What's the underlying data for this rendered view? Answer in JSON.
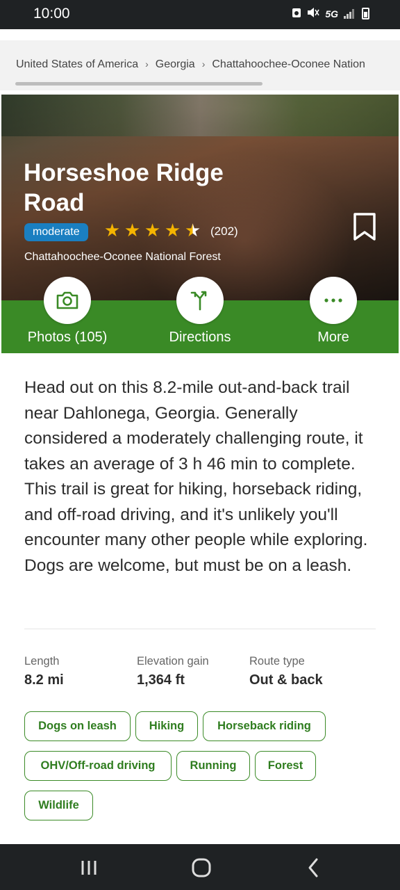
{
  "status_bar": {
    "time": "10:00",
    "network": "5G"
  },
  "breadcrumb": {
    "items": [
      "United States of America",
      "Georgia",
      "Chattahoochee-Oconee Nation"
    ],
    "separator": "›"
  },
  "hero": {
    "title": "Horseshoe Ridge Road",
    "difficulty": "moderate",
    "rating": 4.5,
    "rating_max": 5,
    "reviews": "(202)",
    "park": "Chattahoochee-Oconee National Forest"
  },
  "actions": {
    "photos_label": "Photos (105)",
    "directions_label": "Directions",
    "more_label": "More"
  },
  "description": "Head out on this 8.2-mile out-and-back trail near Dahlonega, Georgia. Generally considered a moderately challenging route, it takes an average of 3 h 46 min to complete. This trail is great for hiking, horseback riding, and off-road driving, and it's unlikely you'll encounter many other people while exploring. Dogs are welcome, but must be on a leash.",
  "stats": {
    "length": {
      "label": "Length",
      "value": "8.2 mi"
    },
    "elevation": {
      "label": "Elevation gain",
      "value": "1,364 ft"
    },
    "route": {
      "label": "Route type",
      "value": "Out & back"
    }
  },
  "tags": [
    "Dogs on leash",
    "Hiking",
    "Horseback riding",
    "OHV/Off-road driving",
    "Running",
    "Forest",
    "Wildlife"
  ],
  "colors": {
    "accent_green": "#3a8a26",
    "difficulty_blue": "#1a7fc1",
    "star": "#f5b400"
  }
}
